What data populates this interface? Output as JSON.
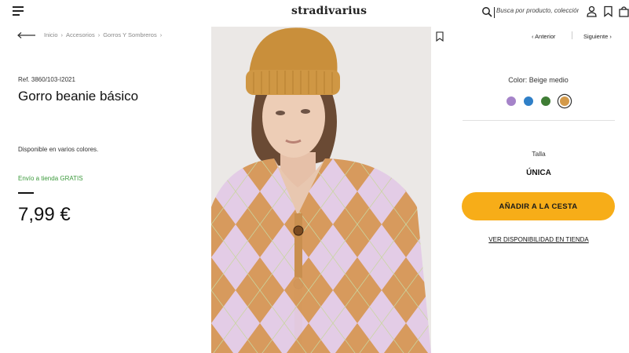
{
  "header": {
    "logo": "stradivarius",
    "search_placeholder": "Busca por producto, colección..."
  },
  "breadcrumb": [
    "Inicio",
    "Accesorios",
    "Gorros Y Sombreros"
  ],
  "product": {
    "ref": "Ref. 3860/103-I2021",
    "title": "Gorro beanie básico",
    "availability": "Disponible en varios colores.",
    "shipping": "Envío a tienda GRATIS",
    "price": "7,99 €"
  },
  "navigation": {
    "prev": "‹ Anterior",
    "next": "Siguiente ›"
  },
  "color": {
    "label": "Color: Beige medio",
    "swatches": [
      "#a583c9",
      "#2f7fc7",
      "#3f7d35",
      "#d49a4a"
    ],
    "selected_index": 3
  },
  "size": {
    "label": "Talla",
    "value": "ÚNICA"
  },
  "actions": {
    "add_to_cart": "AÑADIR A LA CESTA",
    "store_availability": "VER DISPONIBILIDAD EN TIENDA"
  },
  "colors": {
    "accent": "#f7ad18",
    "shipping_green": "#3c9a3c"
  }
}
